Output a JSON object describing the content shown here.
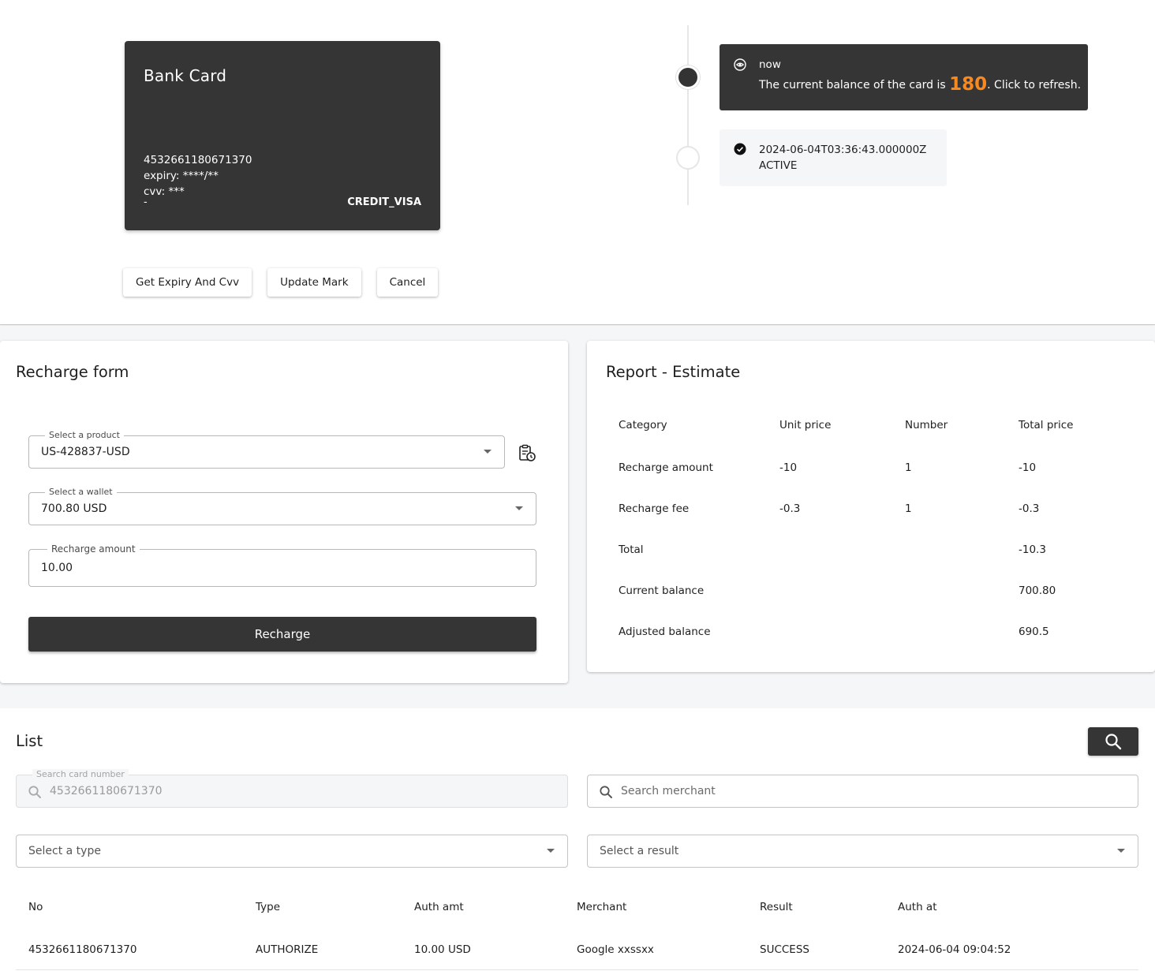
{
  "card": {
    "title": "Bank Card",
    "number": "4532661180671370",
    "expiry": "expiry: ****/**",
    "cvv": "cvv: ***",
    "mark": "-",
    "type": "CREDIT_VISA",
    "bg_color": "#353535"
  },
  "card_actions": {
    "get_expiry_cvv": "Get Expiry And Cvv",
    "update_mark": "Update Mark",
    "cancel": "Cancel"
  },
  "timeline": {
    "balance": {
      "when": "now",
      "prefix": "The current balance of the card is",
      "amount": "180",
      "suffix": ". Click to refresh.",
      "amount_color": "#f7891f",
      "icon": "eye-icon"
    },
    "status": {
      "timestamp": "2024-06-04T03:36:43.000000Z",
      "state": "ACTIVE",
      "icon": "check-circle-icon"
    }
  },
  "recharge_form": {
    "title": "Recharge form",
    "product": {
      "label": "Select a product",
      "value": "US-428837-USD"
    },
    "wallet": {
      "label": "Select a wallet",
      "value": "700.80 USD"
    },
    "amount": {
      "label": "Recharge amount",
      "value": "10.00"
    },
    "submit": "Recharge"
  },
  "report": {
    "title": "Report - Estimate",
    "headers": [
      "Category",
      "Unit price",
      "Number",
      "Total price"
    ],
    "rows": [
      [
        "Recharge amount",
        "-10",
        "1",
        "-10"
      ],
      [
        "Recharge fee",
        "-0.3",
        "1",
        "-0.3"
      ],
      [
        "Total",
        "",
        "",
        "-10.3"
      ],
      [
        "Current balance",
        "",
        "",
        "700.80"
      ],
      [
        "Adjusted balance",
        "",
        "",
        "690.5"
      ]
    ]
  },
  "list": {
    "title": "List",
    "search_card": {
      "label": "Search card number",
      "value": "4532661180671370"
    },
    "search_merchant": {
      "placeholder": "Search merchant"
    },
    "select_type": "Select a type",
    "select_result": "Select a result",
    "headers": [
      "No",
      "Type",
      "Auth amt",
      "Merchant",
      "Result",
      "Auth at"
    ],
    "rows": [
      [
        "4532661180671370",
        "AUTHORIZE",
        "10.00 USD",
        "Google xxssxx",
        "SUCCESS",
        "2024-06-04 09:04:52"
      ]
    ]
  }
}
